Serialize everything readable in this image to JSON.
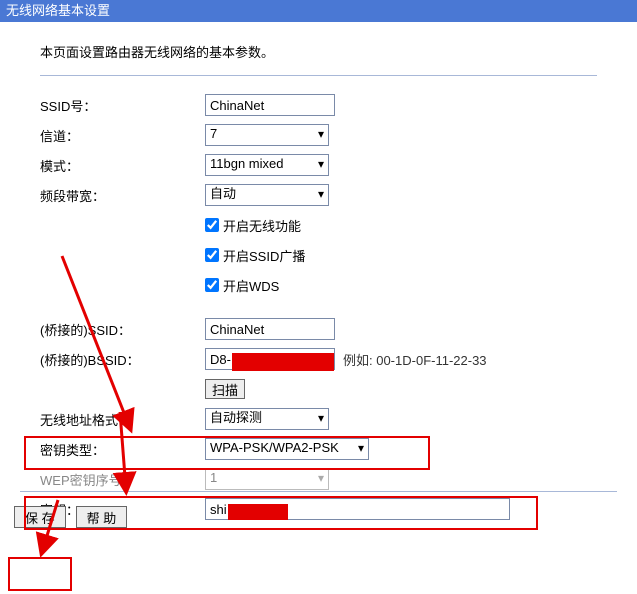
{
  "title": "无线网络基本设置",
  "intro": "本页面设置路由器无线网络的基本参数。",
  "labels": {
    "ssid": "SSID号：",
    "channel": "信道：",
    "mode": "模式：",
    "bandwidth": "频段带宽：",
    "enable_wireless": "开启无线功能",
    "enable_ssid_broadcast": "开启SSID广播",
    "enable_wds": "开启WDS",
    "bridged_ssid": "(桥接的)SSID：",
    "bridged_bssid": "(桥接的)BSSID：",
    "bssid_example": "例如: 00-1D-0F-11-22-33",
    "scan": "扫描",
    "addr_format": "无线地址格式：",
    "key_type": "密钥类型：",
    "wep_index": "WEP密钥序号：",
    "key": "密钥：",
    "save": "保 存",
    "help": "帮 助"
  },
  "values": {
    "ssid": "ChinaNet",
    "channel": "7",
    "mode": "11bgn mixed",
    "bandwidth": "自动",
    "enable_wireless": true,
    "enable_ssid_broadcast": true,
    "enable_wds": true,
    "bridged_ssid": "ChinaNet",
    "bridged_bssid": "D8-1",
    "addr_format": "自动探测",
    "key_type": "WPA-PSK/WPA2-PSK",
    "wep_index": "1",
    "key": "shi"
  }
}
